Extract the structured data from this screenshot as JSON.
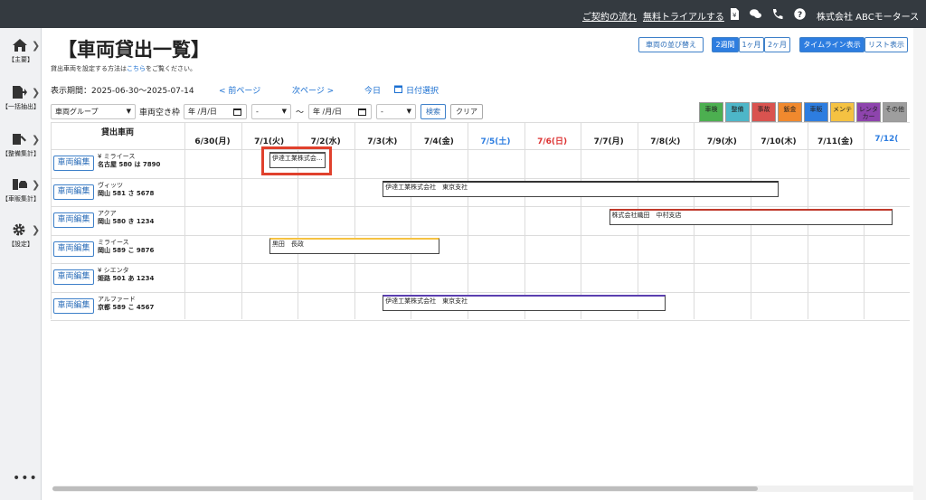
{
  "topbar": {
    "contract_flow": "ご契約の流れ",
    "free_trial": "無料トライアルする",
    "icons": [
      "document-yen-icon",
      "chat-icon",
      "phone-icon",
      "help-icon"
    ],
    "company": "株式会社 ABCモータース"
  },
  "sidebar": {
    "items": [
      {
        "icon": "home-icon",
        "label": "【主要】"
      },
      {
        "icon": "export-icon",
        "label": "【一括抽出】"
      },
      {
        "icon": "maintenance-icon",
        "label": "【整備集計】"
      },
      {
        "icon": "car-icon",
        "label": "【車販集計】"
      },
      {
        "icon": "gear-icon",
        "label": "【設定】"
      }
    ],
    "more": "•••"
  },
  "header": {
    "title": "【車両貸出一覧】",
    "note_prefix": "貸出車両を設定する方法は",
    "note_link": "こちら",
    "note_suffix": "をご覧ください。",
    "sort_button": "車両の並び替え",
    "ranges": [
      "2週間",
      "1ヶ月",
      "2ヶ月"
    ],
    "active_range": "2週間",
    "views": [
      "タイムライン表示",
      "リスト表示"
    ],
    "active_view": "タイムライン表示"
  },
  "nav": {
    "period": "表示期間：2025-06-30〜2025-07-14",
    "prev": "< 前ページ",
    "next": "次ページ >",
    "today": "今日",
    "date_select": "日付選択"
  },
  "filters": {
    "vehicle_group": "車両グループ",
    "free_label": "車両空き枠",
    "date_placeholder": "年 /月/日",
    "time_placeholder": "-",
    "tilde": "〜",
    "search": "検索",
    "clear": "クリア"
  },
  "categories": [
    {
      "label": "車検",
      "color": "#4caf50"
    },
    {
      "label": "整備",
      "color": "#4db6c8"
    },
    {
      "label": "事故",
      "color": "#d9534f"
    },
    {
      "label": "鈑金",
      "color": "#f0892e"
    },
    {
      "label": "車販",
      "color": "#2d7de0"
    },
    {
      "label": "メンテ",
      "color": "#f5c242"
    },
    {
      "label": "レンタカー",
      "color": "#8e44ad"
    },
    {
      "label": "その他",
      "color": "#9e9e9e"
    }
  ],
  "timeline": {
    "corner_label": "貸出車両",
    "dates": [
      {
        "label": "6/30(月)",
        "kind": "weekday"
      },
      {
        "label": "7/1(火)",
        "kind": "weekday"
      },
      {
        "label": "7/2(水)",
        "kind": "weekday"
      },
      {
        "label": "7/3(木)",
        "kind": "weekday"
      },
      {
        "label": "7/4(金)",
        "kind": "weekday"
      },
      {
        "label": "7/5(土)",
        "kind": "sat"
      },
      {
        "label": "7/6(日)",
        "kind": "sun"
      },
      {
        "label": "7/7(月)",
        "kind": "weekday"
      },
      {
        "label": "7/8(火)",
        "kind": "weekday"
      },
      {
        "label": "7/9(水)",
        "kind": "weekday"
      },
      {
        "label": "7/10(木)",
        "kind": "weekday"
      },
      {
        "label": "7/11(金)",
        "kind": "weekday"
      },
      {
        "label": "7/12(",
        "kind": "sat"
      }
    ],
    "edit_label": "車両編集",
    "vehicles": [
      {
        "name": "¥ ミライース",
        "plate": "名古屋 580 は 7890"
      },
      {
        "name": "ヴィッツ",
        "plate": "岡山 581 さ 5678"
      },
      {
        "name": "アクア",
        "plate": "岡山 580 き 1234"
      },
      {
        "name": "ミライース",
        "plate": "岡山 589 こ 9876"
      },
      {
        "name": "¥ シエンタ",
        "plate": "姫路 501 あ 1234"
      },
      {
        "name": "アルファード",
        "plate": "京都 589 こ 4567"
      }
    ],
    "bookings": [
      {
        "row": 0,
        "start": 1.5,
        "end": 2.5,
        "text": "伊達工業株式会...",
        "color": "#555555",
        "highlighted": true
      },
      {
        "row": 1,
        "start": 3.5,
        "end": 10.5,
        "text": "伊達工業株式会社　東京支社",
        "color": "#333333",
        "highlighted": false
      },
      {
        "row": 2,
        "start": 7.5,
        "end": 12.5,
        "text": "株式会社織田　中村支店",
        "color": "#c0392b",
        "highlighted": false
      },
      {
        "row": 3,
        "start": 1.5,
        "end": 4.5,
        "text": "黒田　長政",
        "color": "#f5c242",
        "highlighted": false
      },
      {
        "row": 5,
        "start": 3.5,
        "end": 8.5,
        "text": "伊達工業株式会社　東京支社",
        "color": "#5b3fb0",
        "highlighted": false
      }
    ]
  }
}
